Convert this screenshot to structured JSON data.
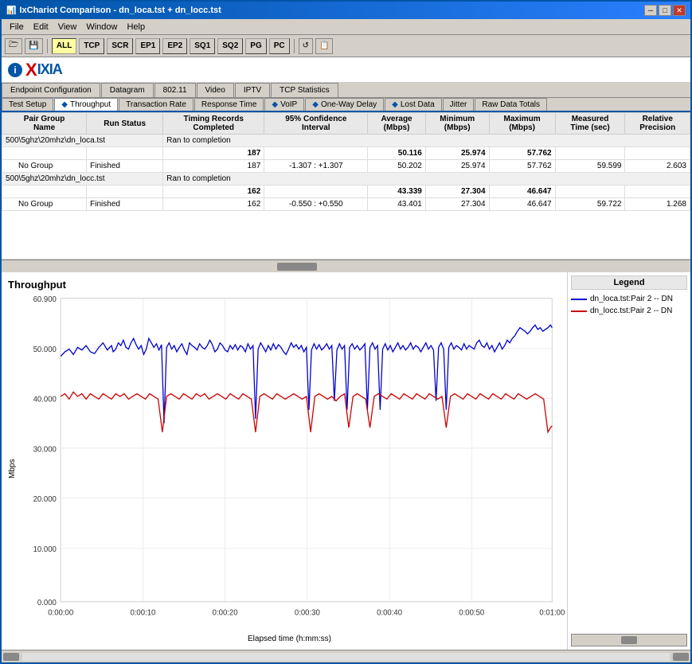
{
  "window": {
    "title": "IxChariot Comparison - dn_loca.tst + dn_locc.tst"
  },
  "title_buttons": {
    "minimize": "─",
    "maximize": "□",
    "close": "✕"
  },
  "menu": {
    "items": [
      "File",
      "Edit",
      "View",
      "Window",
      "Help"
    ]
  },
  "toolbar": {
    "buttons": [
      "ALL",
      "TCP",
      "SCR",
      "EP1",
      "EP2",
      "SQ1",
      "SQ2",
      "PG",
      "PC"
    ]
  },
  "logo": {
    "prefix": "X",
    "text": "IXIA"
  },
  "tabs_row1": [
    {
      "label": "Endpoint Configuration",
      "active": false
    },
    {
      "label": "Datagram",
      "active": false
    },
    {
      "label": "802.11",
      "active": false
    },
    {
      "label": "Video",
      "active": false
    },
    {
      "label": "IPTV",
      "active": false
    },
    {
      "label": "TCP Statistics",
      "active": false
    }
  ],
  "tabs_row2": [
    {
      "label": "Test Setup",
      "active": false
    },
    {
      "label": "Throughput",
      "active": true
    },
    {
      "label": "Transaction Rate",
      "active": false
    },
    {
      "label": "Response Time",
      "active": false
    },
    {
      "label": "VoIP",
      "active": false
    },
    {
      "label": "One-Way Delay",
      "active": false
    },
    {
      "label": "Lost Data",
      "active": false
    },
    {
      "label": "Jitter",
      "active": false
    },
    {
      "label": "Raw Data Totals",
      "active": false
    }
  ],
  "table": {
    "headers": [
      "Pair Group Name",
      "Run Status",
      "Timing Records Completed",
      "95% Confidence Interval",
      "Average (Mbps)",
      "Minimum (Mbps)",
      "Maximum (Mbps)",
      "Measured Time (sec)",
      "Relative Precision"
    ],
    "rows": [
      {
        "type": "filename",
        "filename": "500\\5ghz\\20mhz\\dn_loca.tst",
        "run_status": "Ran to completion",
        "timing": "",
        "confidence": "",
        "average": "",
        "minimum": "",
        "maximum": "",
        "measured": "",
        "precision": ""
      },
      {
        "type": "summary",
        "filename": "",
        "run_status": "",
        "timing": "187",
        "confidence": "",
        "average": "50.116",
        "minimum": "25.974",
        "maximum": "57.762",
        "measured": "",
        "precision": ""
      },
      {
        "type": "data",
        "group": "No Group",
        "run_status": "Finished",
        "timing": "187",
        "confidence": "-1.307 : +1.307",
        "average": "50.202",
        "minimum": "25.974",
        "maximum": "57.762",
        "measured": "59.599",
        "precision": "2.603"
      },
      {
        "type": "filename",
        "filename": "500\\5ghz\\20mhz\\dn_locc.tst",
        "run_status": "Ran to completion",
        "timing": "",
        "confidence": "",
        "average": "",
        "minimum": "",
        "maximum": "",
        "measured": "",
        "precision": ""
      },
      {
        "type": "summary",
        "filename": "",
        "run_status": "",
        "timing": "162",
        "confidence": "",
        "average": "43.339",
        "minimum": "27.304",
        "maximum": "46.647",
        "measured": "",
        "precision": ""
      },
      {
        "type": "data",
        "group": "No Group",
        "run_status": "Finished",
        "timing": "162",
        "confidence": "-0.550 : +0.550",
        "average": "43.401",
        "minimum": "27.304",
        "maximum": "46.647",
        "measured": "59.722",
        "precision": "1.268"
      }
    ]
  },
  "chart": {
    "title": "Throughput",
    "y_label": "Mbps",
    "x_label": "Elapsed time (h:mm:ss)",
    "y_axis": [
      "60.900",
      "50.000",
      "40.000",
      "30.000",
      "20.000",
      "10.000",
      "0.000"
    ],
    "x_axis": [
      "0:00:00",
      "0:00:10",
      "0:00:20",
      "0:00:30",
      "0:00:40",
      "0:00:50",
      "0:01:00"
    ]
  },
  "legend": {
    "title": "Legend",
    "items": [
      {
        "label": "dn_loca.tst:Pair 2 -- DN",
        "color": "#0000cc"
      },
      {
        "label": "dn_locc.tst:Pair 2 -- DN",
        "color": "#cc0000"
      }
    ]
  }
}
